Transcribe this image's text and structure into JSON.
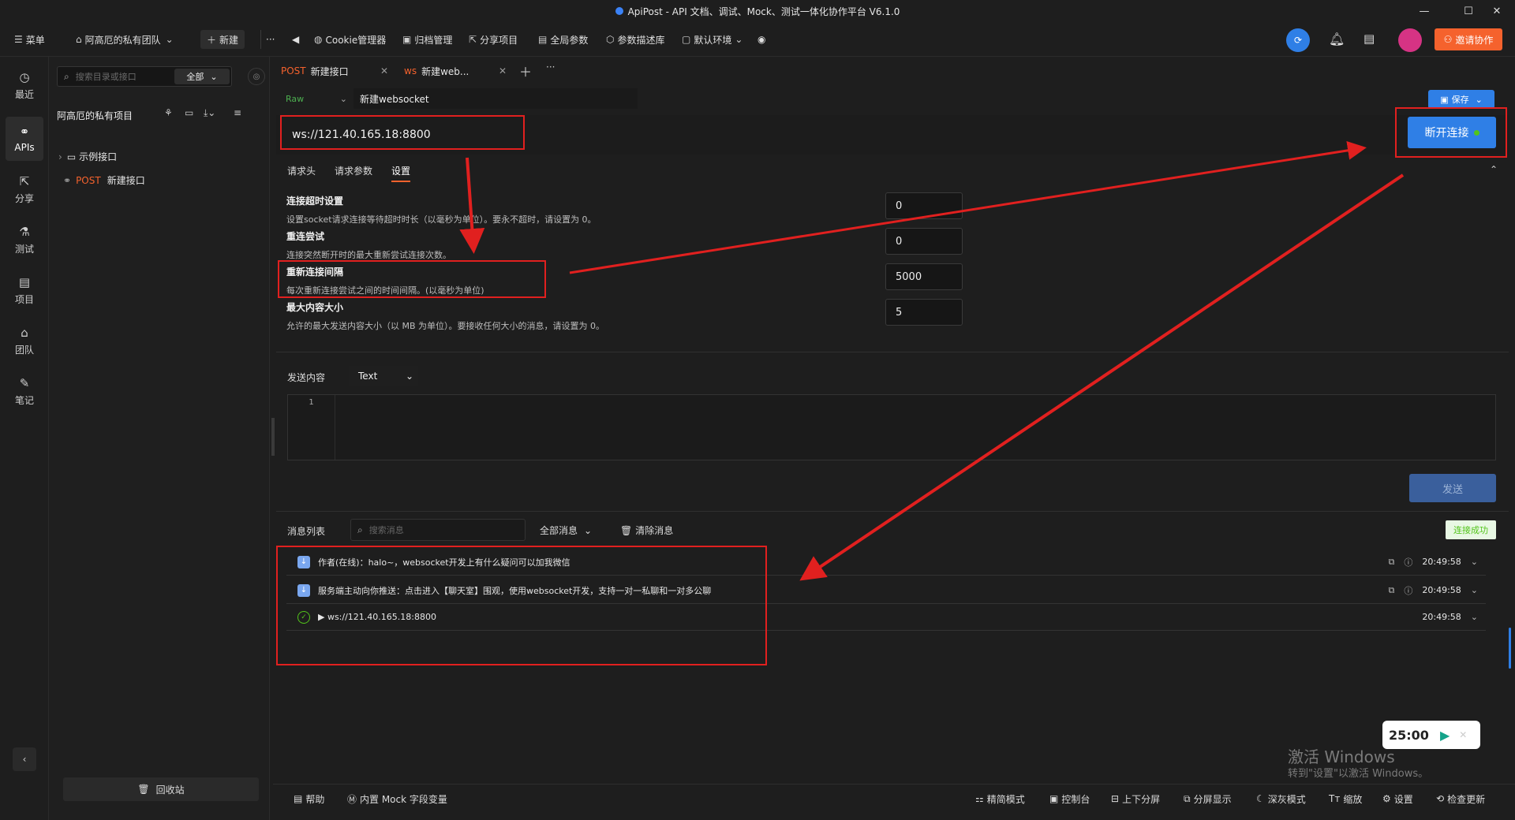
{
  "window": {
    "title": "ApiPost - API 文档、调试、Mock、测试一体化协作平台 V6.1.0"
  },
  "toolbar": {
    "menu": "菜单",
    "team": "阿高厄的私有团队",
    "new": "新建",
    "more": "···",
    "cookie": "Cookie管理器",
    "archive": "归档管理",
    "share": "分享项目",
    "globals": "全局参数",
    "params_lib": "参数描述库",
    "env": "默认环境",
    "invite": "邀请协作"
  },
  "nav": {
    "recent": "最近",
    "apis": "APIs",
    "share": "分享",
    "test": "测试",
    "project": "项目",
    "team": "团队",
    "notes": "笔记"
  },
  "tree": {
    "search_placeholder": "搜索目录或接口",
    "filter": "全部",
    "project_name": "阿高厄的私有项目",
    "items": [
      {
        "label": "示例接口"
      },
      {
        "method": "POST",
        "label": "新建接口"
      }
    ],
    "recycle": "回收站"
  },
  "tabs": [
    {
      "method": "POST",
      "label": "新建接口"
    },
    {
      "method": "ws",
      "label": "新建web..."
    }
  ],
  "request": {
    "mode": "Raw",
    "name": "新建websocket",
    "save": "保存",
    "url": "ws://121.40.165.18:8800",
    "disconnect": "断开连接"
  },
  "subtabs": [
    "请求头",
    "请求参数",
    "设置"
  ],
  "settings": [
    {
      "title": "连接超时设置",
      "desc": "设置socket请求连接等待超时时长（以毫秒为单位）。要永不超时，请设置为 0。",
      "value": "0"
    },
    {
      "title": "重连尝试",
      "desc": "连接突然断开时的最大重新尝试连接次数。",
      "value": "0"
    },
    {
      "title": "重新连接间隔",
      "desc": "每次重新连接尝试之间的时间间隔。(以毫秒为单位)",
      "value": "5000"
    },
    {
      "title": "最大内容大小",
      "desc": "允许的最大发送内容大小（以 MB 为单位）。要接收任何大小的消息，请设置为 0。",
      "value": "5"
    }
  ],
  "send": {
    "label": "发送内容",
    "type": "Text",
    "line": "1",
    "button": "发送"
  },
  "messages": {
    "label": "消息列表",
    "search_placeholder": "搜索消息",
    "filter": "全部消息",
    "clear": "清除消息",
    "status": "连接成功",
    "rows": [
      {
        "text": "作者(在线)：halo~，websocket开发上有什么疑问可以加我微信",
        "time": "20:49:58"
      },
      {
        "text": "服务端主动向你推送：点击进入【聊天室】围观，使用websocket开发，支持一对一私聊和一对多公聊",
        "time": "20:49:58"
      },
      {
        "text": "▶ ws://121.40.165.18:8800",
        "time": "20:49:58"
      }
    ]
  },
  "timer": {
    "value": "25:00"
  },
  "watermark": {
    "line1": "激活 Windows",
    "line2": "转到\"设置\"以激活 Windows。"
  },
  "bottom": {
    "help": "帮助",
    "mock": "内置 Mock 字段变量",
    "simple": "精简模式",
    "console": "控制台",
    "split_v": "上下分屏",
    "split_show": "分屏显示",
    "theme": "深灰模式",
    "zoom": "缩放",
    "settings": "设置",
    "update": "检查更新"
  },
  "colors": {
    "accent": "#2f7fe6",
    "brand_orange": "#f5622d",
    "annotation_red": "#e1201f",
    "post": "#f5622d",
    "success": "#52c41a"
  }
}
